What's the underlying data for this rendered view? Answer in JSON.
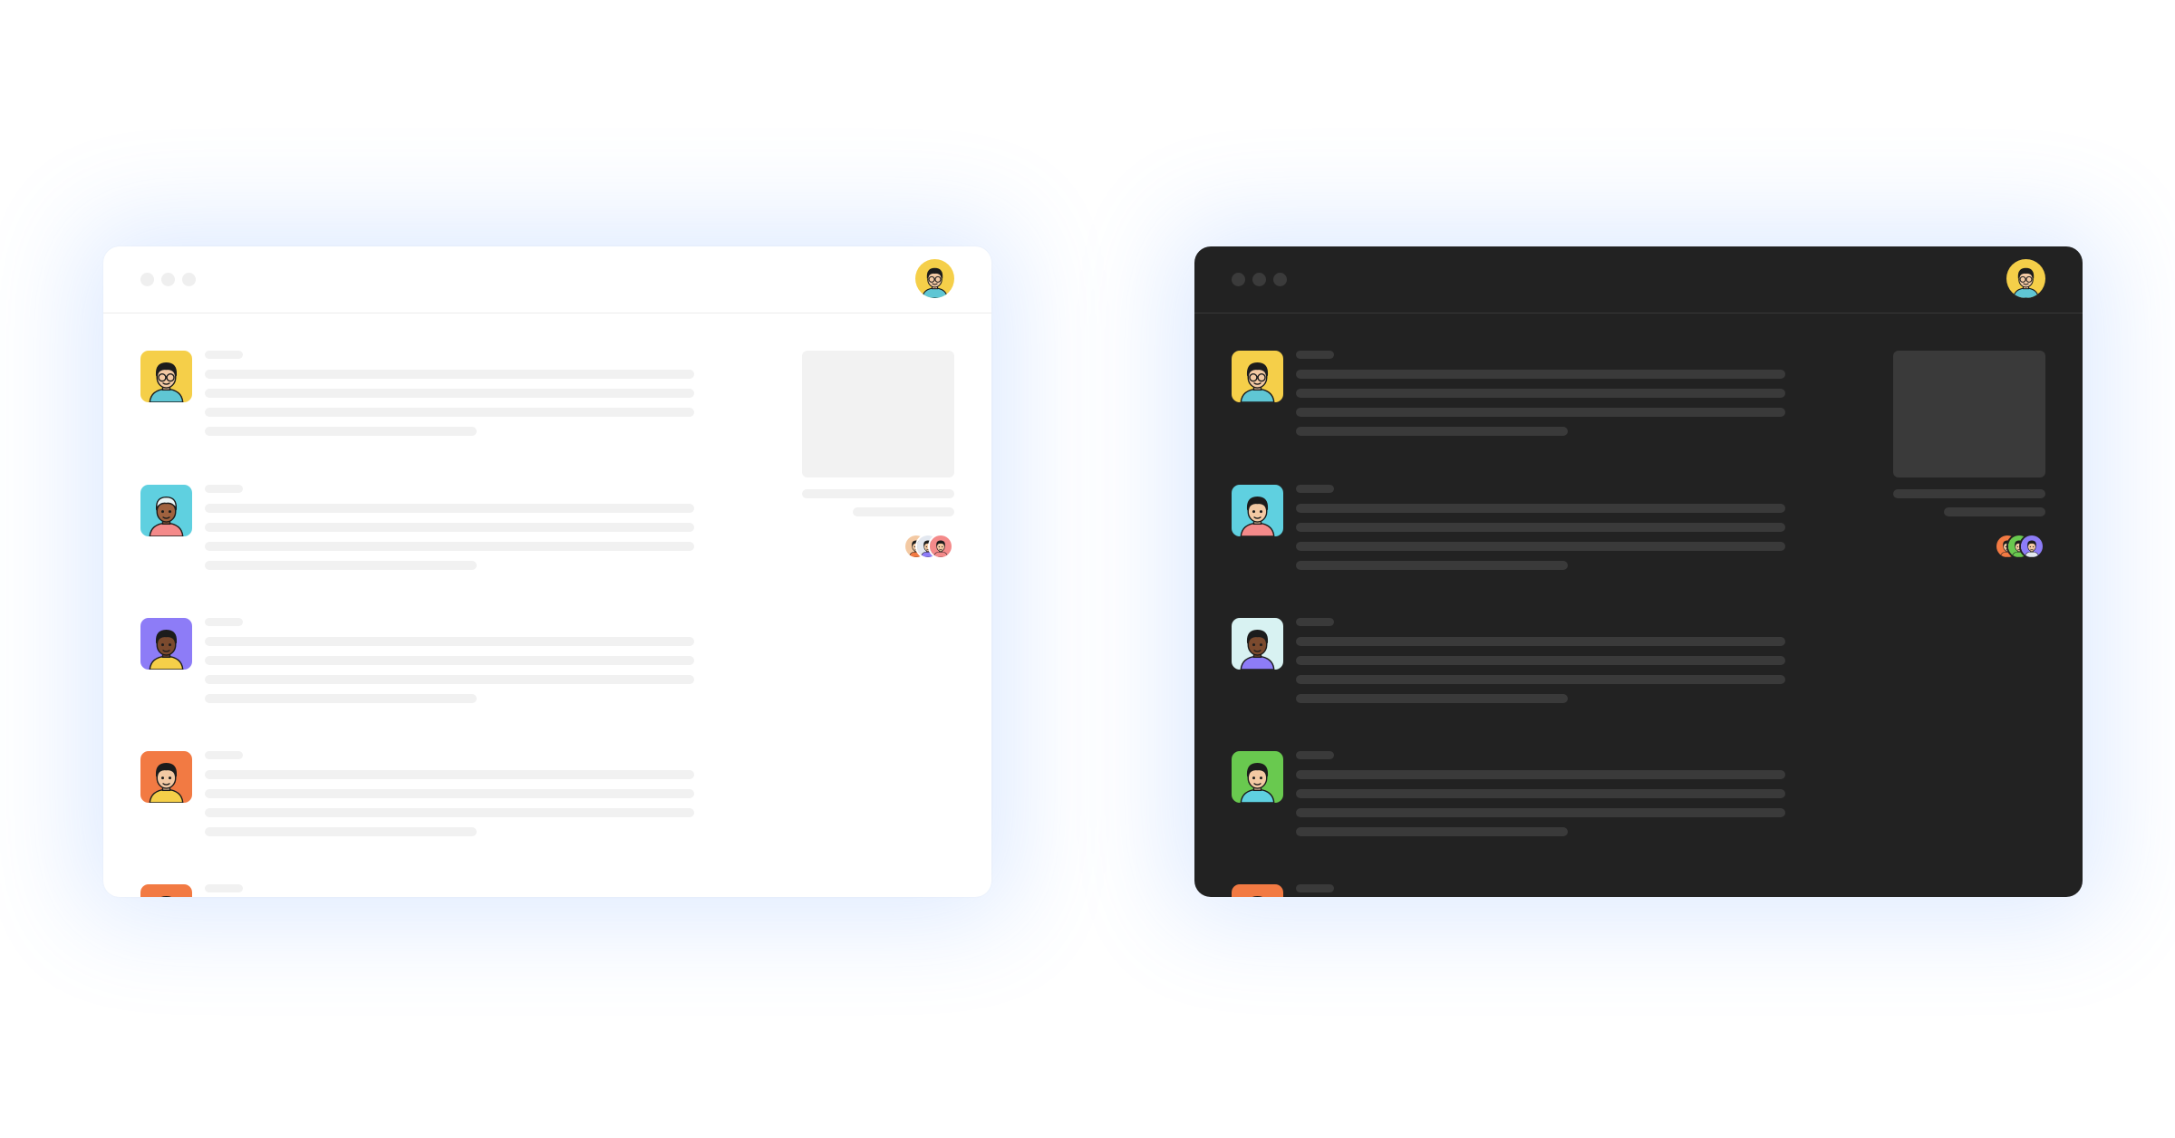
{
  "windows": [
    {
      "theme": "light",
      "colors": {
        "background": "#ffffff",
        "skeleton": "#f1f1f1",
        "divider": "#ececec"
      },
      "user_avatar": {
        "icon": "person-glasses-avatar-icon",
        "bg": "#f5cf49",
        "skin": "#f3c9a3",
        "hair": "#1c1c1c",
        "shirt": "#5fc6d4"
      },
      "feed": [
        {
          "icon": "person-glasses-avatar-icon",
          "bg": "#f5cf49",
          "skin": "#f3c9a3",
          "hair": "#1c1c1c",
          "shirt": "#5fc6d4"
        },
        {
          "icon": "person-avatar-icon",
          "bg": "#5fd0e0",
          "skin": "#a0623f",
          "hair": "#e9f3f4",
          "shirt": "#f48a8a"
        },
        {
          "icon": "person-avatar-icon",
          "bg": "#8d7cf7",
          "skin": "#7b4a2e",
          "hair": "#1c1c1c",
          "shirt": "#f5cf49"
        },
        {
          "icon": "person-avatar-icon",
          "bg": "#f27a43",
          "skin": "#f3c9a3",
          "hair": "#1c1c1c",
          "shirt": "#f5cf49"
        },
        {
          "icon": "person-avatar-icon",
          "bg": "#f27a43",
          "skin": "#f3c9a3",
          "hair": "#3c6ee8",
          "shirt": "#f5cf49"
        }
      ],
      "side_avatars": [
        {
          "icon": "person-avatar-icon",
          "bg": "#f3c9a3",
          "skin": "#f3c9a3",
          "hair": "#1c1c1c",
          "shirt": "#f27a43"
        },
        {
          "icon": "person-avatar-icon",
          "bg": "#e3e8f0",
          "skin": "#f3c9a3",
          "hair": "#1c1c1c",
          "shirt": "#8d7cf7"
        },
        {
          "icon": "person-avatar-icon",
          "bg": "#f48a8a",
          "skin": "#f3c9a3",
          "hair": "#1c1c1c",
          "shirt": "#f48a8a"
        }
      ]
    },
    {
      "theme": "dark",
      "colors": {
        "background": "#222222",
        "skeleton": "#3a3a3a",
        "divider": "#383838"
      },
      "user_avatar": {
        "icon": "person-glasses-avatar-icon",
        "bg": "#f5cf49",
        "skin": "#f3c9a3",
        "hair": "#1c1c1c",
        "shirt": "#5fc6d4"
      },
      "feed": [
        {
          "icon": "person-glasses-avatar-icon",
          "bg": "#f5cf49",
          "skin": "#f3c9a3",
          "hair": "#1c1c1c",
          "shirt": "#5fc6d4"
        },
        {
          "icon": "person-avatar-icon",
          "bg": "#5fd0e0",
          "skin": "#f3c9a3",
          "hair": "#1c1c1c",
          "shirt": "#f48a8a"
        },
        {
          "icon": "person-avatar-icon",
          "bg": "#d8f2f2",
          "skin": "#7b4a2e",
          "hair": "#1c1c1c",
          "shirt": "#8d7cf7"
        },
        {
          "icon": "person-avatar-icon",
          "bg": "#69c94f",
          "skin": "#f3c9a3",
          "hair": "#1c1c1c",
          "shirt": "#5fd0e0"
        },
        {
          "icon": "person-avatar-icon",
          "bg": "#f27a43",
          "skin": "#f3c9a3",
          "hair": "#7a3a22",
          "shirt": "#f5cf49"
        }
      ],
      "side_avatars": [
        {
          "icon": "person-avatar-icon",
          "bg": "#f27a43",
          "skin": "#f3c9a3",
          "hair": "#1c1c1c",
          "shirt": "#f27a43"
        },
        {
          "icon": "person-avatar-icon",
          "bg": "#69c94f",
          "skin": "#f3c9a3",
          "hair": "#1c1c1c",
          "shirt": "#69c94f"
        },
        {
          "icon": "person-avatar-icon",
          "bg": "#8d7cf7",
          "skin": "#f3c9a3",
          "hair": "#1c1c1c",
          "shirt": "#e3e8f0"
        }
      ]
    }
  ]
}
